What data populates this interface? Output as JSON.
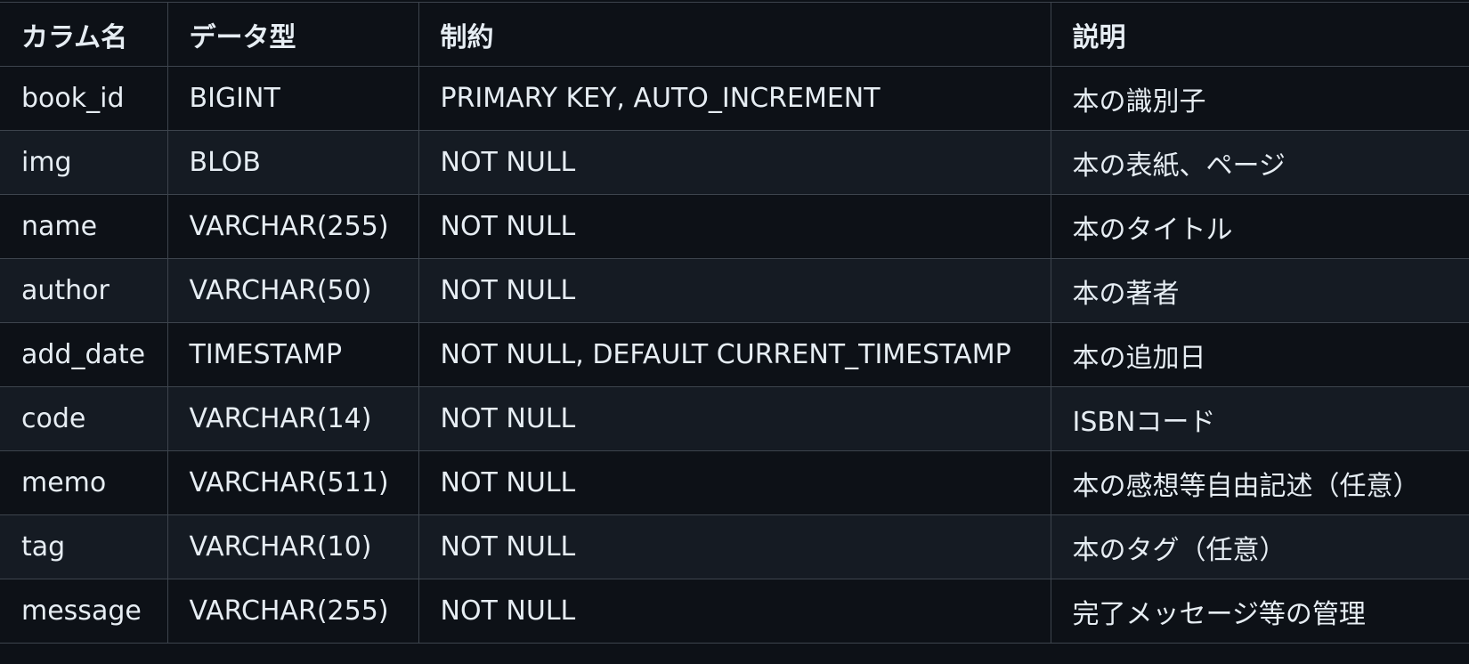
{
  "table": {
    "headers": [
      "カラム名",
      "データ型",
      "制約",
      "説明"
    ],
    "rows": [
      [
        "book_id",
        "BIGINT",
        "PRIMARY KEY, AUTO_INCREMENT",
        "本の識別子"
      ],
      [
        "img",
        "BLOB",
        "NOT NULL",
        "本の表紙、ページ"
      ],
      [
        "name",
        "VARCHAR(255)",
        "NOT NULL",
        "本のタイトル"
      ],
      [
        "author",
        "VARCHAR(50)",
        "NOT NULL",
        "本の著者"
      ],
      [
        "add_date",
        "TIMESTAMP",
        "NOT NULL, DEFAULT CURRENT_TIMESTAMP",
        "本の追加日"
      ],
      [
        "code",
        "VARCHAR(14)",
        "NOT NULL",
        "ISBNコード"
      ],
      [
        "memo",
        "VARCHAR(511)",
        "NOT NULL",
        "本の感想等自由記述（任意）"
      ],
      [
        "tag",
        "VARCHAR(10)",
        "NOT NULL",
        "本のタグ（任意）"
      ],
      [
        "message",
        "VARCHAR(255)",
        "NOT NULL",
        "完了メッセージ等の管理"
      ]
    ]
  },
  "colors": {
    "background": "#0d1117",
    "row_alt": "#151b23",
    "border": "#3d444d",
    "text": "#e6edf3"
  }
}
